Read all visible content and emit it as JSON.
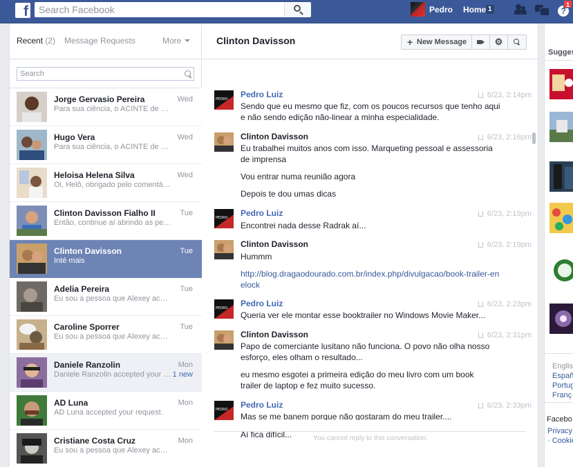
{
  "topbar": {
    "search_placeholder": "Search Facebook",
    "user_name": "Pedro",
    "home_label": "Home",
    "home_count": "1",
    "notification_count": "1"
  },
  "left": {
    "tab_recent": "Recent",
    "tab_recent_count": "(2)",
    "tab_requests": "Message Requests",
    "tab_more": "More",
    "search_placeholder": "Search",
    "conversations": [
      {
        "name": "Jorge Gervasio Pereira",
        "snippet": "Para sua ciência, o ACINTE de Cl...",
        "day": "Wed",
        "new": ""
      },
      {
        "name": "Hugo Vera",
        "snippet": "Para sua ciência, o ACINTE de Cl...",
        "day": "Wed",
        "new": ""
      },
      {
        "name": "Heloisa Helena Silva",
        "snippet": "Oi, Helô, obrigado pelo comentári...",
        "day": "Wed",
        "new": ""
      },
      {
        "name": "Clinton Davisson Fialho II",
        "snippet": "Então, continue aí abrindo as pern...",
        "day": "Tue",
        "new": ""
      },
      {
        "name": "Clinton Davisson",
        "snippet": "Inté mais",
        "day": "Tue",
        "new": ""
      },
      {
        "name": "Adelia Pereira",
        "snippet": "Eu sou a pessoa que Alexey acus...",
        "day": "Tue",
        "new": ""
      },
      {
        "name": "Caroline Sporrer",
        "snippet": "Eu sou a pessoa que Alexey acus...",
        "day": "Tue",
        "new": ""
      },
      {
        "name": "Daniele Ranzolin",
        "snippet": "Daniele Ranzolin accepted your r...",
        "day": "Mon",
        "new": "1 new"
      },
      {
        "name": "AD Luna",
        "snippet": "AD Luna accepted your request.",
        "day": "Mon",
        "new": ""
      },
      {
        "name": "Cristiane Costa Cruz",
        "snippet": "Eu sou a pessoa que Alexey acus...",
        "day": "Mon",
        "new": ""
      }
    ]
  },
  "thread": {
    "title": "Clinton Davisson",
    "new_message_label": "New Message",
    "gear_glyph": "⚙",
    "groups": [
      {
        "sender": "Pedro Luiz",
        "time": "6/23, 2:14pm",
        "lines": [
          "Sendo que eu mesmo que fiz, com os poucos recursos que tenho aqui e não sendo edição não-linear a minha especialidade."
        ]
      },
      {
        "sender": "Clinton Davisson",
        "time": "6/23, 2:16pm",
        "lines": [
          "Eu trabalhei muitos anos com isso. Marqueting pessoal e assessoria de imprensa",
          "Vou entrar numa reunião agora",
          "Depois te dou umas dicas"
        ]
      },
      {
        "sender": "Pedro Luiz",
        "time": "6/23, 2:19pm",
        "lines": [
          "Encontrei nada desse Radrak aí..."
        ]
      },
      {
        "sender": "Clinton Davisson",
        "time": "6/23, 2:19pm",
        "lines": [
          "Hummm",
          "http://blog.dragaodourado.com.br/index.php/divulgacao/book-trailer-enelock"
        ]
      },
      {
        "sender": "Pedro Luiz",
        "time": "6/23, 2:23pm",
        "lines": [
          "Queria ver ele montar esse booktrailer no Windows Movie Maker..."
        ]
      },
      {
        "sender": "Clinton Davisson",
        "time": "6/23, 2:31pm",
        "lines": [
          "Papo de comerciante lusitano não funciona. O povo não olha nosso esforço, eles olham o resultado...",
          "eu mesmo esgotei a primeira edição do meu livro com um book trailer de laptop e fez muito sucesso."
        ]
      },
      {
        "sender": "Pedro Luiz",
        "time": "6/23, 2:33pm",
        "lines": [
          "Mas se me banem porque não gostaram do meu trailer....",
          "Aí fica difícil..."
        ]
      }
    ],
    "no_reply_notice": "You cannot reply to this conversation."
  },
  "right": {
    "section_title": "Sugges",
    "languages": [
      "English",
      "Españ",
      "Portug",
      "Franç"
    ],
    "footer_brand": "Facebo",
    "footer_links": [
      "Privacy",
      "· Cookie"
    ]
  },
  "colors": {
    "brand_blue": "#3b5998",
    "selected_row": "#6d84b4",
    "link_blue": "#4267b2",
    "notif_red": "#fa3e3e"
  }
}
